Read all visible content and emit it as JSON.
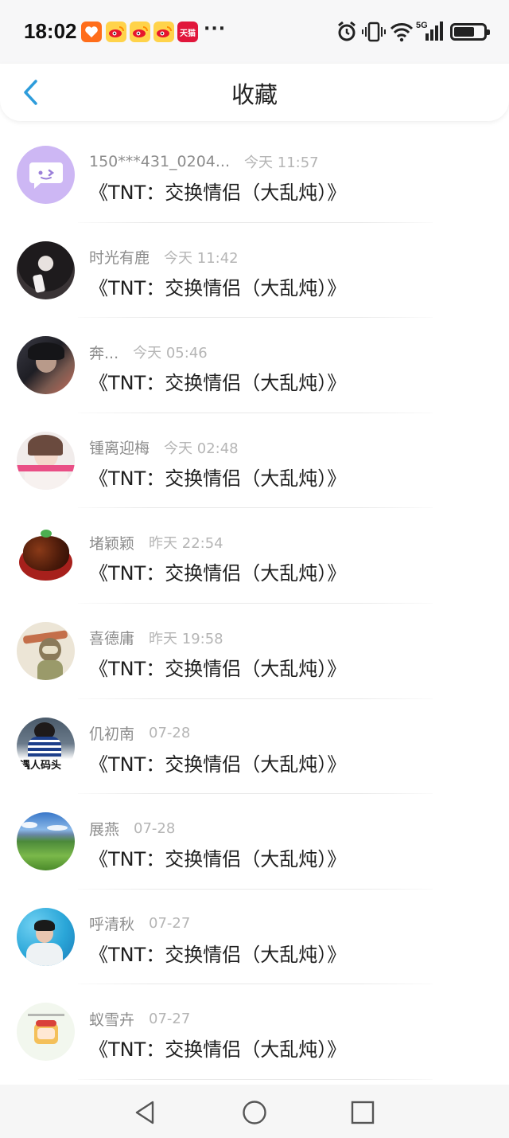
{
  "status_bar": {
    "time": "18:02",
    "notifications": [
      "taobao-icon",
      "weibo-icon",
      "weibo-icon",
      "weibo-icon",
      "tmall-icon"
    ],
    "tmall_label": "天猫",
    "more": "···",
    "network": "5G",
    "battery_level": 0.62
  },
  "header": {
    "title": "收藏",
    "accent_color": "#2d9cdb"
  },
  "items": [
    {
      "user": "150***431_0204...",
      "time": "今天 11:57",
      "title": "《TNT：交换情侣（大乱炖）》"
    },
    {
      "user": "时光有鹿",
      "time": "今天 11:42",
      "title": "《TNT：交换情侣（大乱炖）》"
    },
    {
      "user": "奔...",
      "time": "今天 05:46",
      "title": "《TNT：交换情侣（大乱炖）》"
    },
    {
      "user": "锺离迎梅",
      "time": "今天 02:48",
      "title": "《TNT：交换情侣（大乱炖）》"
    },
    {
      "user": "堵颖颖",
      "time": "昨天 22:54",
      "title": "《TNT：交换情侣（大乱炖）》"
    },
    {
      "user": "喜德庸",
      "time": "昨天 19:58",
      "title": "《TNT：交换情侣（大乱炖）》"
    },
    {
      "user": "仉初南",
      "time": "07-28",
      "title": "《TNT：交换情侣（大乱炖）》",
      "avatar_caption": "遇人码头"
    },
    {
      "user": "展燕",
      "time": "07-28",
      "title": "《TNT：交换情侣（大乱炖）》"
    },
    {
      "user": "呼清秋",
      "time": "07-27",
      "title": "《TNT：交换情侣（大乱炖）》"
    },
    {
      "user": "蚁雪卉",
      "time": "07-27",
      "title": "《TNT：交换情侣（大乱炖）》"
    }
  ],
  "nav": {
    "buttons": [
      "back-triangle-icon",
      "home-circle-icon",
      "recents-square-icon"
    ]
  }
}
